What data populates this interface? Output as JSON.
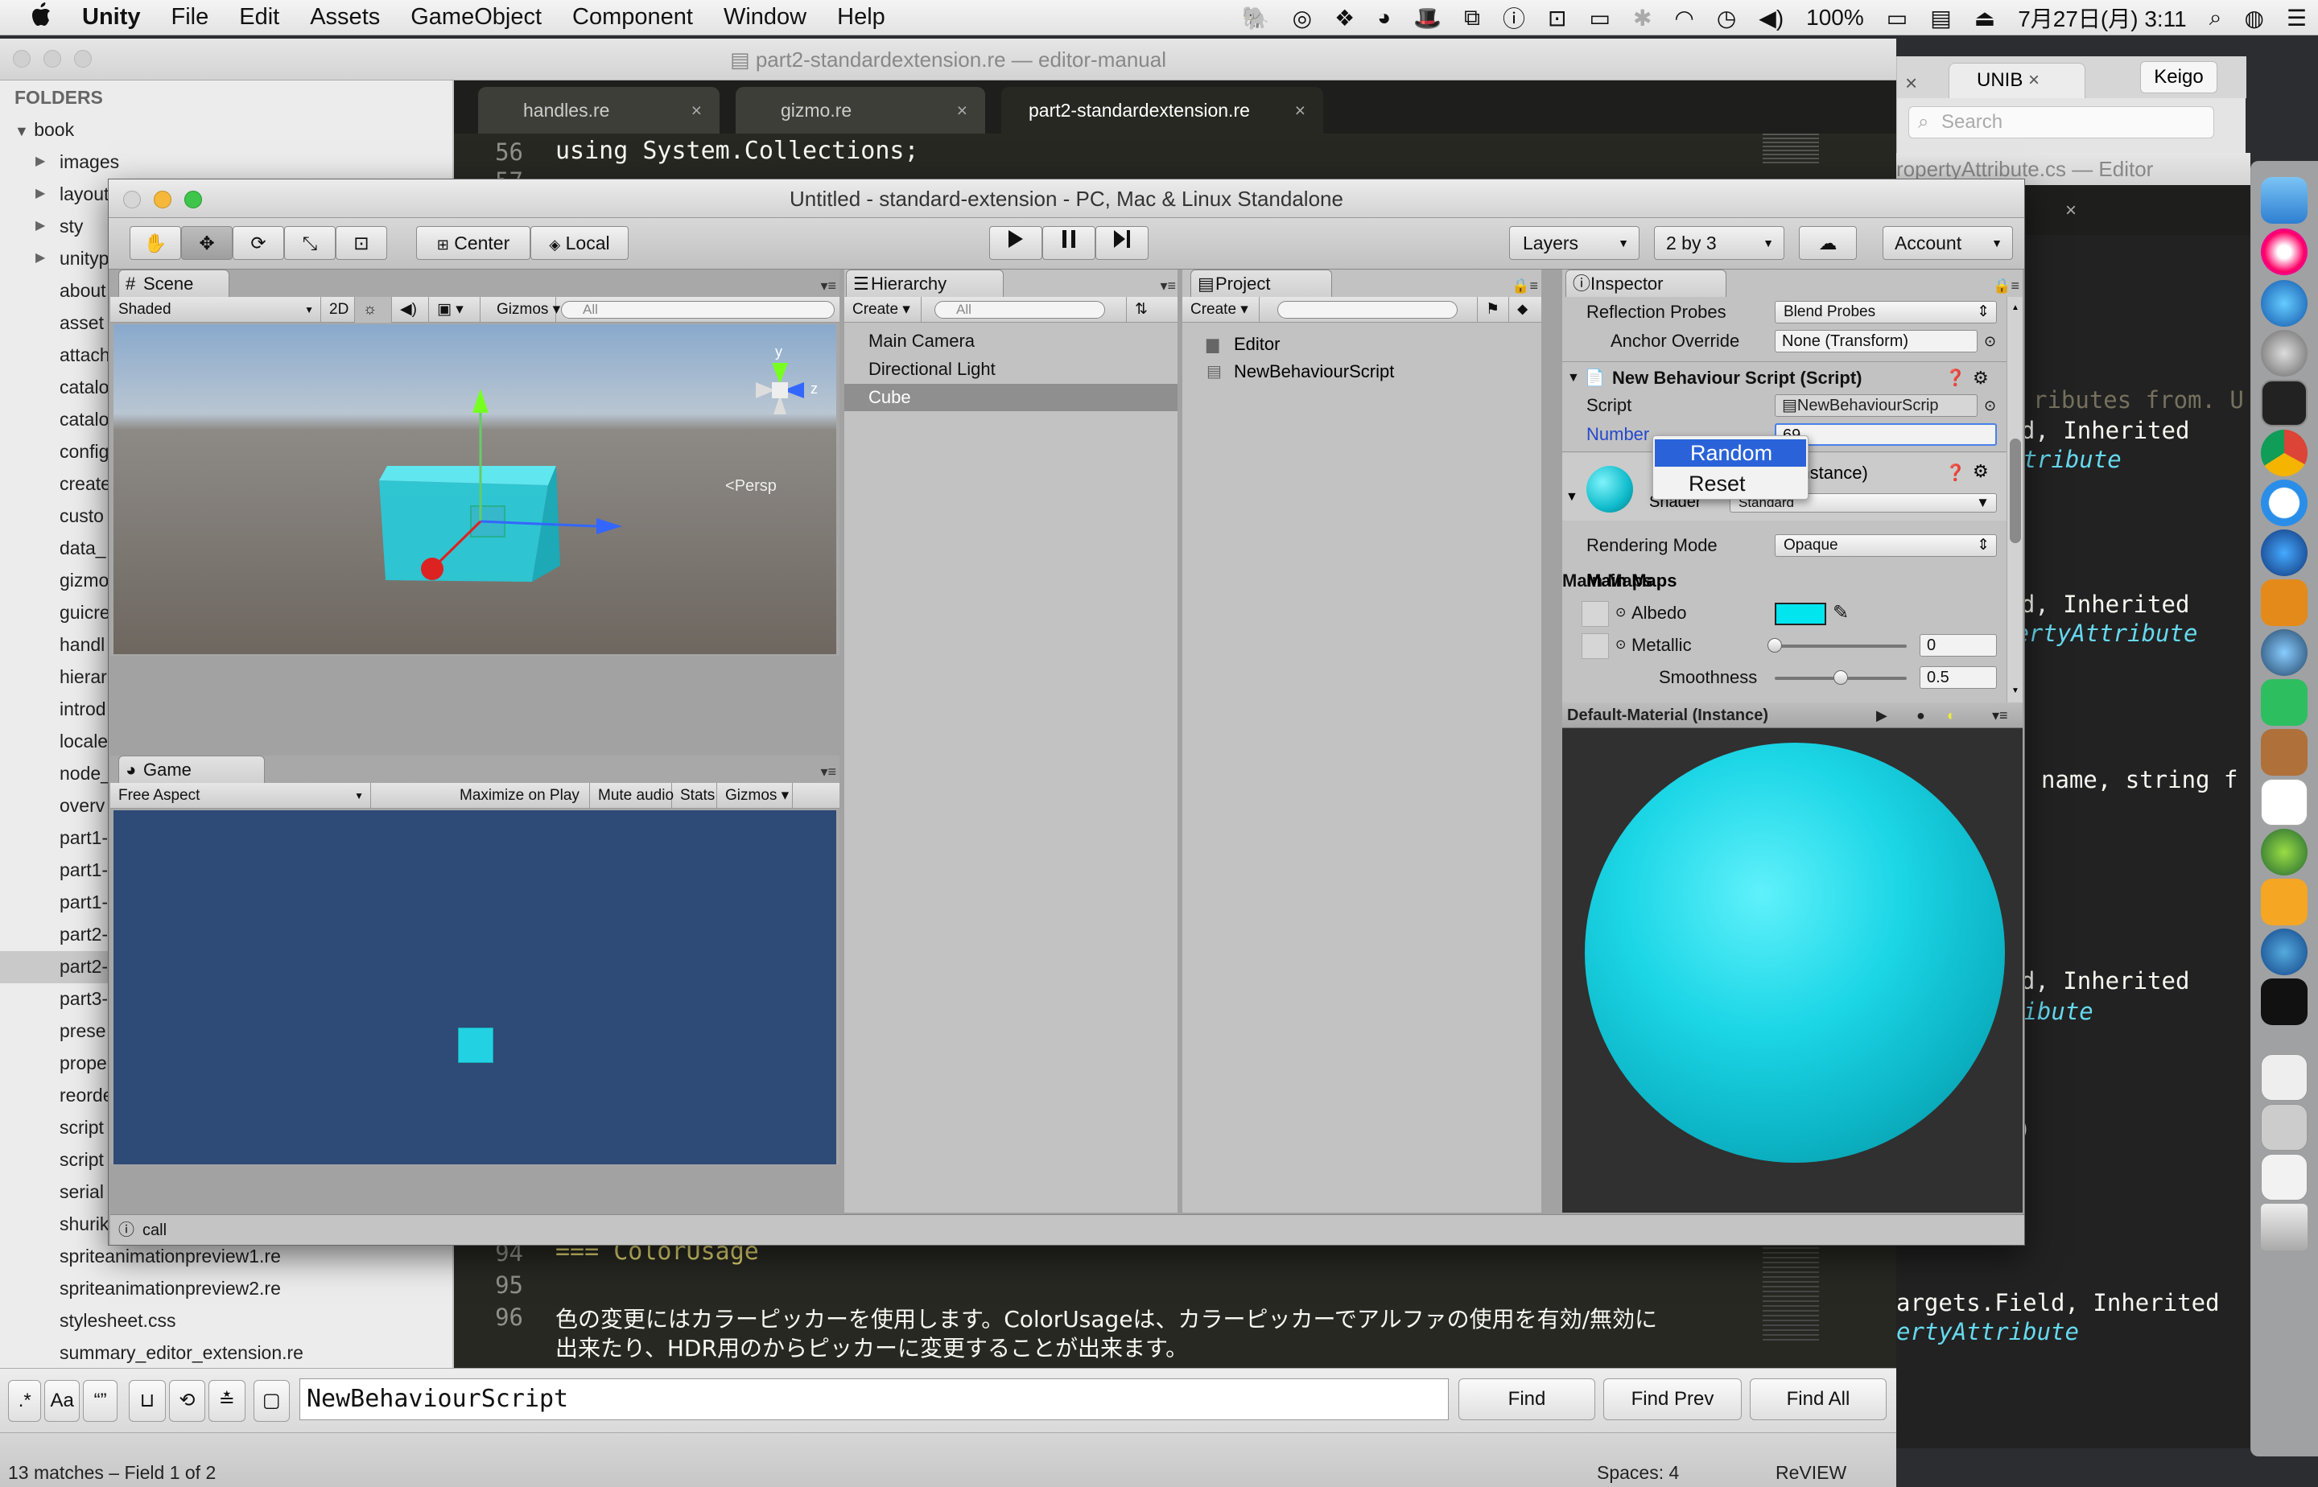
{
  "menubar": {
    "apple": "",
    "app": "Unity",
    "items": [
      "File",
      "Edit",
      "Assets",
      "GameObject",
      "Component",
      "Window",
      "Help"
    ],
    "battery": "100%",
    "clock": "7月27日(月) 3:11"
  },
  "sublime": {
    "title": "part2-standardextension.re — editor-manual",
    "folders_label": "FOLDERS",
    "root": "book",
    "tree": [
      {
        "label": "images",
        "folder": true
      },
      {
        "label": "layout",
        "folder": true
      },
      {
        "label": "sty",
        "folder": true
      },
      {
        "label": "unityp",
        "folder": true
      },
      {
        "label": "about"
      },
      {
        "label": "asset"
      },
      {
        "label": "attach"
      },
      {
        "label": "catalo"
      },
      {
        "label": "catalo"
      },
      {
        "label": "config"
      },
      {
        "label": "create"
      },
      {
        "label": "custo"
      },
      {
        "label": "data_"
      },
      {
        "label": "gizmo"
      },
      {
        "label": "guicre"
      },
      {
        "label": "handl"
      },
      {
        "label": "hierar"
      },
      {
        "label": "introd"
      },
      {
        "label": "locale"
      },
      {
        "label": "node_"
      },
      {
        "label": "overv"
      },
      {
        "label": "part1-"
      },
      {
        "label": "part1-"
      },
      {
        "label": "part1-"
      },
      {
        "label": "part2-"
      },
      {
        "label": "part2-",
        "selected": true
      },
      {
        "label": "part3-"
      },
      {
        "label": "prese"
      },
      {
        "label": "prope"
      },
      {
        "label": "reorde"
      },
      {
        "label": "script"
      },
      {
        "label": "script"
      },
      {
        "label": "serial"
      },
      {
        "label": "shurik"
      },
      {
        "label": "spriteanimationpreview1.re"
      },
      {
        "label": "spriteanimationpreview2.re"
      },
      {
        "label": "stylesheet.css"
      },
      {
        "label": "summary_editor_extension.re"
      }
    ],
    "tabs": [
      {
        "label": "handles.re",
        "close": "×"
      },
      {
        "label": "gizmo.re",
        "close": "×"
      },
      {
        "label": "part2-standardextension.re",
        "close": "×",
        "active": true
      }
    ],
    "code_top": [
      {
        "ln": "56",
        "text": "using System.Collections;"
      },
      {
        "ln": "57",
        "text": ""
      }
    ],
    "code_bottom": [
      {
        "ln": "94",
        "text": "=== ColorUsage"
      },
      {
        "ln": "95",
        "text": ""
      },
      {
        "ln": "96",
        "text": "色の変更にはカラーピッカーを使用します。ColorUsageは、カラーピッカーでアルファの使用を有効/無効に"
      },
      {
        "ln": "",
        "text": "出来たり、HDR用のからピッカーに変更することが出来ます。"
      },
      {
        "ln": "97",
        "text": ""
      }
    ],
    "find": {
      "query": "NewBehaviourScript",
      "find": "Find",
      "find_prev": "Find Prev",
      "find_all": "Find All",
      "opt_aa": "Aa",
      "opt_quote": "“”"
    },
    "status": {
      "left": "13 matches – Field 1 of 2",
      "spaces": "Spaces: 4",
      "syntax": "ReVIEW"
    }
  },
  "browser": {
    "tab": "UNIB",
    "close": "×",
    "user": "Keigo",
    "search": "Search"
  },
  "right_editor": {
    "title": "ropertyAttribute.cs — Editor",
    "close": "×",
    "lines": [
      {
        "a": "ributes from. U",
        "b": ""
      },
      {
        "a": "eld, Inherited ",
        "b": "ttribute"
      },
      {
        "a": "eld, Inherited ",
        "b": "pertyAttribute"
      },
      {
        "a": "name, string f",
        "b": ""
      },
      {
        "a": "eld, Inherited ",
        "b": "ribute"
      },
      {
        "a": ")",
        "b": ""
      },
      {
        "a": "argets.Field, Inherited ",
        "b": "ertyAttribute"
      }
    ]
  },
  "unity": {
    "title": "Untitled - standard-extension - PC, Mac & Linux Standalone",
    "pivot": "Center",
    "space": "Local",
    "layers": "Layers",
    "layout": "2 by 3",
    "account": "Account",
    "scene": {
      "tab": "Scene",
      "shading": "Shaded",
      "mode2d": "2D",
      "gizmos": "Gizmos",
      "search": "All",
      "persp": "Persp",
      "axis_y": "y",
      "axis_z": "z"
    },
    "game": {
      "tab": "Game",
      "aspect": "Free Aspect",
      "maximize": "Maximize on Play",
      "mute": "Mute audio",
      "stats": "Stats",
      "gizmos": "Gizmos",
      "background": "#2e4a76"
    },
    "hierarchy": {
      "tab": "Hierarchy",
      "create": "Create",
      "search": "All",
      "items": [
        {
          "label": "Main Camera"
        },
        {
          "label": "Directional Light"
        },
        {
          "label": "Cube",
          "selected": true
        }
      ]
    },
    "project": {
      "tab": "Project",
      "create": "Create",
      "items": [
        {
          "label": "Editor",
          "icon": "folder-icon"
        },
        {
          "label": "NewBehaviourScript",
          "icon": "script-icon"
        }
      ]
    },
    "inspector": {
      "tab": "Inspector",
      "reflection_probes": {
        "label": "Reflection Probes",
        "value": "Blend Probes"
      },
      "anchor_override": {
        "label": "Anchor Override",
        "value": "None (Transform)"
      },
      "component": "New Behaviour Script (Script)",
      "script": {
        "label": "Script",
        "value": "NewBehaviourScrip"
      },
      "number": {
        "label": "Number",
        "value": "69"
      },
      "material_suffix": "(Instance)",
      "shader": {
        "label": "Shader",
        "value": "Standard"
      },
      "rendering_mode": {
        "label": "Rendering Mode",
        "value": "Opaque"
      },
      "main_maps": "Main Maps",
      "albedo": {
        "label": "Albedo",
        "color": "#00e5ee"
      },
      "metallic": {
        "label": "Metallic",
        "value": "0",
        "level": 0
      },
      "smoothness": {
        "label": "Smoothness",
        "value": "0.5",
        "level": 0.5
      },
      "preview_title": "Default-Material (Instance)"
    },
    "context_menu": {
      "items": [
        {
          "label": "Random",
          "highlighted": true
        },
        {
          "label": "Reset"
        }
      ]
    },
    "console": "call",
    "accent_cyan": "#22c8d8",
    "accent_blue": "#2a63d9"
  }
}
